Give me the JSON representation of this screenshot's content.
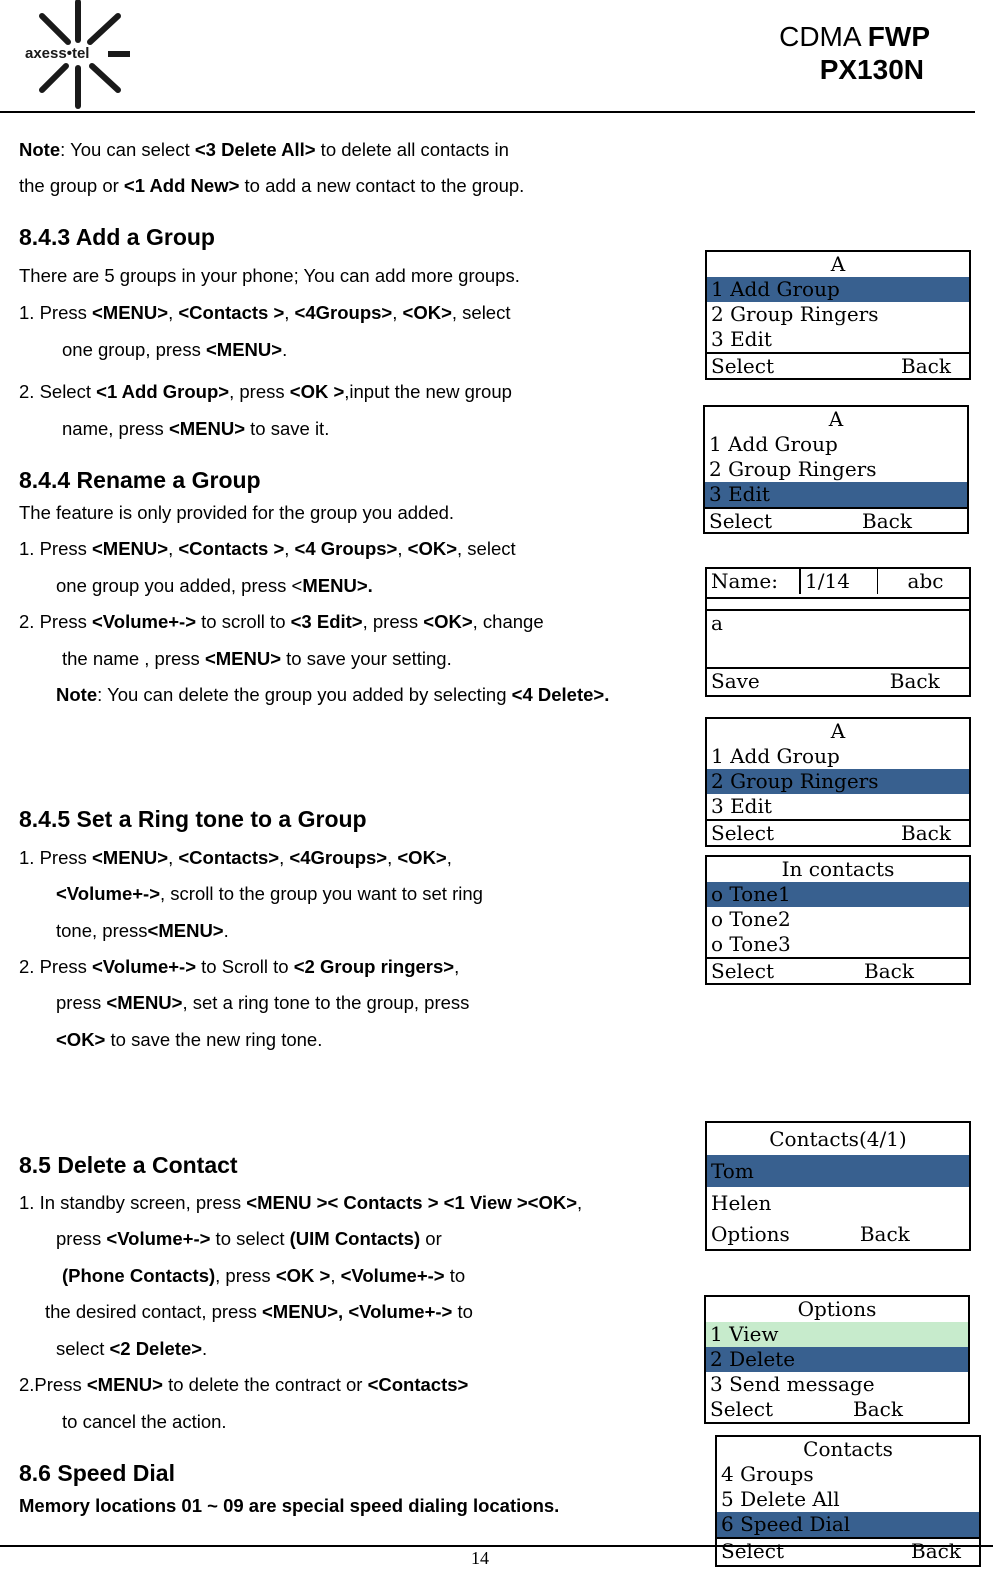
{
  "header": {
    "brand": "axess•tel",
    "title_prefix": "CDMA",
    "title_bold": "FWP",
    "model": "PX130N"
  },
  "content": {
    "note1": {
      "line1": [
        "Note",
        ": You can select ",
        "<3 Delete All>",
        " to delete all contacts in"
      ],
      "line2": [
        "the group or ",
        "<1 Add New>",
        " to add a new contact to the group."
      ]
    },
    "s843": {
      "heading": "8.4.3   Add a Group",
      "intro": "There are 5 groups in your phone; You can add more groups.",
      "step1_a": [
        "1.    Press ",
        "<MENU>",
        ", ",
        "<Contacts >",
        ", ",
        "<4Groups>",
        ", ",
        "<OK>",
        ", select"
      ],
      "step1_b": [
        "one group, press ",
        "<MENU>",
        "."
      ],
      "step2_a": [
        "2.    Select ",
        "<1 Add Group>",
        ", press ",
        "<OK >",
        ",input the new group"
      ],
      "step2_b": [
        "name, press ",
        "<MENU>",
        " to save it."
      ]
    },
    "s844": {
      "heading": "8.4.4   Rename a Group",
      "intro": "The feature is only provided for the group you added.",
      "step1_a": [
        "1.    Press ",
        "<MENU>",
        ", ",
        "<Contacts >",
        ", ",
        "<4 Groups>",
        ", ",
        "<OK>",
        ", select"
      ],
      "step1_b": [
        "one group you added, press <",
        "MENU>."
      ],
      "step2_a": [
        "2.    Press ",
        "<Volume+->",
        " to scroll to ",
        "<3 Edit>",
        ", press ",
        "<OK>",
        ", change"
      ],
      "step2_b": [
        "the name , press ",
        "<MENU>",
        " to save your setting."
      ],
      "note": [
        "Note",
        ": You can delete the group you added by selecting ",
        "<4 Delete>."
      ]
    },
    "s845": {
      "heading": "8.4.5   Set a Ring tone to a Group",
      "step1_a": [
        "1.    Press ",
        "<MENU>",
        ", ",
        "<Contacts>",
        ", ",
        "<4Groups>",
        ", ",
        "<OK>",
        ","
      ],
      "step1_b": [
        "<Volume+->",
        ", scroll to the group you want to set ring"
      ],
      "step1_c": [
        "tone, press",
        "<MENU>",
        "."
      ],
      "step2_a": [
        "2.    Press ",
        "<Volume+->",
        " to Scroll to ",
        "<2 Group ringers>",
        ","
      ],
      "step2_b": [
        "press ",
        "<MENU>",
        ", set a ring tone to the group, press"
      ],
      "step2_c": [
        "<OK>",
        " to save the new ring tone."
      ]
    },
    "s85": {
      "heading": "8.5    Delete a Contact",
      "l1": [
        "1. In standby screen, press ",
        "<MENU >< Contacts > <1 View ><OK>",
        ","
      ],
      "l2": [
        "press ",
        "<Volume+->",
        " to select ",
        "(UIM Contacts)",
        " or"
      ],
      "l3": [
        "(Phone Contacts)",
        ", press ",
        "<OK >",
        ", ",
        "<Volume+->",
        " to"
      ],
      "l4": [
        "the desired contact, press ",
        "<MENU>, <Volume+->",
        " to"
      ],
      "l5": [
        "select ",
        "<2 Delete>",
        "."
      ],
      "l6": [
        "2.Press ",
        "<MENU>",
        " to delete the contract or ",
        "<Contacts>"
      ],
      "l7": "to cancel the action."
    },
    "s86": {
      "heading": "8.6    Speed Dial",
      "text": "Memory locations 01 ~ 09 are special speed dialing locations."
    }
  },
  "screens": {
    "group_menu_1": {
      "title": "A",
      "items": [
        "1 Add Group",
        "2 Group Ringers",
        "3 Edit"
      ],
      "left": "Select",
      "right": "Back"
    },
    "group_menu_2": {
      "title": "A",
      "items": [
        "1 Add Group",
        "2 Group Ringers",
        "3 Edit"
      ],
      "left": "Select",
      "right": "Back"
    },
    "name_edit": {
      "label": "Name:",
      "counter": "1/14",
      "mode": "abc",
      "value": "a",
      "left": "Save",
      "right": "Back"
    },
    "group_menu_3": {
      "title": "A",
      "items": [
        "1 Add Group",
        "2 Group Ringers",
        "3 Edit"
      ],
      "left": "Select",
      "right": "Back"
    },
    "tones": {
      "title": "In contacts",
      "items": [
        "o Tone1",
        "o Tone2",
        "o Tone3"
      ],
      "left": "Select",
      "right": "Back"
    },
    "contacts_list": {
      "title": "Contacts(4/1)",
      "items": [
        "Tom",
        "Helen"
      ],
      "left": "Options",
      "right": "Back"
    },
    "options": {
      "title": "Options",
      "items": [
        "1 View",
        "2 Delete",
        "3 Send message"
      ],
      "left": "Select",
      "right": "Back"
    },
    "contacts_menu": {
      "title": "Contacts",
      "items": [
        "4 Groups",
        "5 Delete All",
        "6 Speed Dial"
      ],
      "left": "Select",
      "right": "Back"
    }
  },
  "footer": {
    "page_number": "14"
  },
  "colors": {
    "highlight": "#38608f",
    "highlight_alt": "#c7ebcc"
  }
}
